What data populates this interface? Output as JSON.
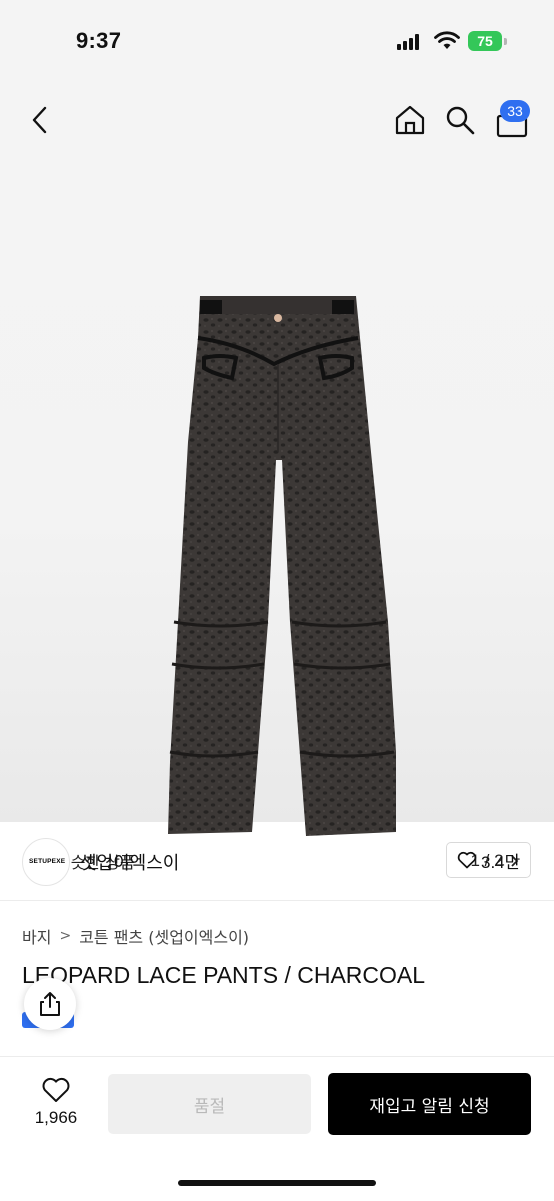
{
  "status": {
    "time": "9:37",
    "battery": "75"
  },
  "header": {
    "cart_count": "33"
  },
  "gallery": {
    "similar_label": "비슷한 상품",
    "pager": "1 / 2"
  },
  "brand": {
    "name": "셋업이엑스이",
    "logo_text": "SETUPEXE",
    "likes": "3.4만"
  },
  "breadcrumb": {
    "level1": "바지",
    "level2": "코튼 팬츠 (셋업이엑스이)"
  },
  "product": {
    "title": "LEOPARD LACE PANTS / CHARCOAL"
  },
  "bottom": {
    "wish_count": "1,966",
    "soldout_label": "품절",
    "restock_label": "재입고 알림 신청"
  },
  "icons": [
    "back-icon",
    "home-icon",
    "search-icon",
    "cart-icon",
    "similar-icon",
    "chevron-right-icon",
    "heart-icon",
    "share-icon"
  ]
}
